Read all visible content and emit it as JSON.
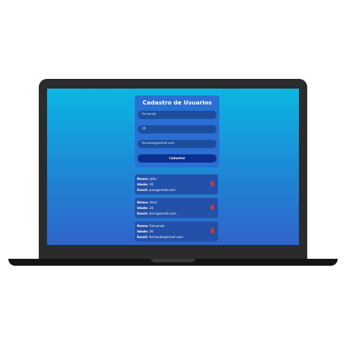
{
  "form": {
    "title": "Cadastro de Usuarios",
    "name_value": "Fernando",
    "age_value": "26",
    "email_value": "fernando@email.com",
    "submit_label": "Cadastrar"
  },
  "labels": {
    "name": "Nome:",
    "age": "Idade:",
    "email": "Email:"
  },
  "users": [
    {
      "name": "João",
      "age": "35",
      "email": "joao@email.com"
    },
    {
      "name": "Alice",
      "age": "24",
      "email": "alice@email.com"
    },
    {
      "name": "Fernando",
      "age": "26",
      "email": "fernando@email.com"
    }
  ],
  "colors": {
    "screen_top": "#0bb6e3",
    "screen_bottom": "#2f64c9",
    "card": "#2350a8",
    "button": "#0b2f8f",
    "delete": "#e0352b"
  },
  "icons": {
    "delete": "trash-icon"
  }
}
